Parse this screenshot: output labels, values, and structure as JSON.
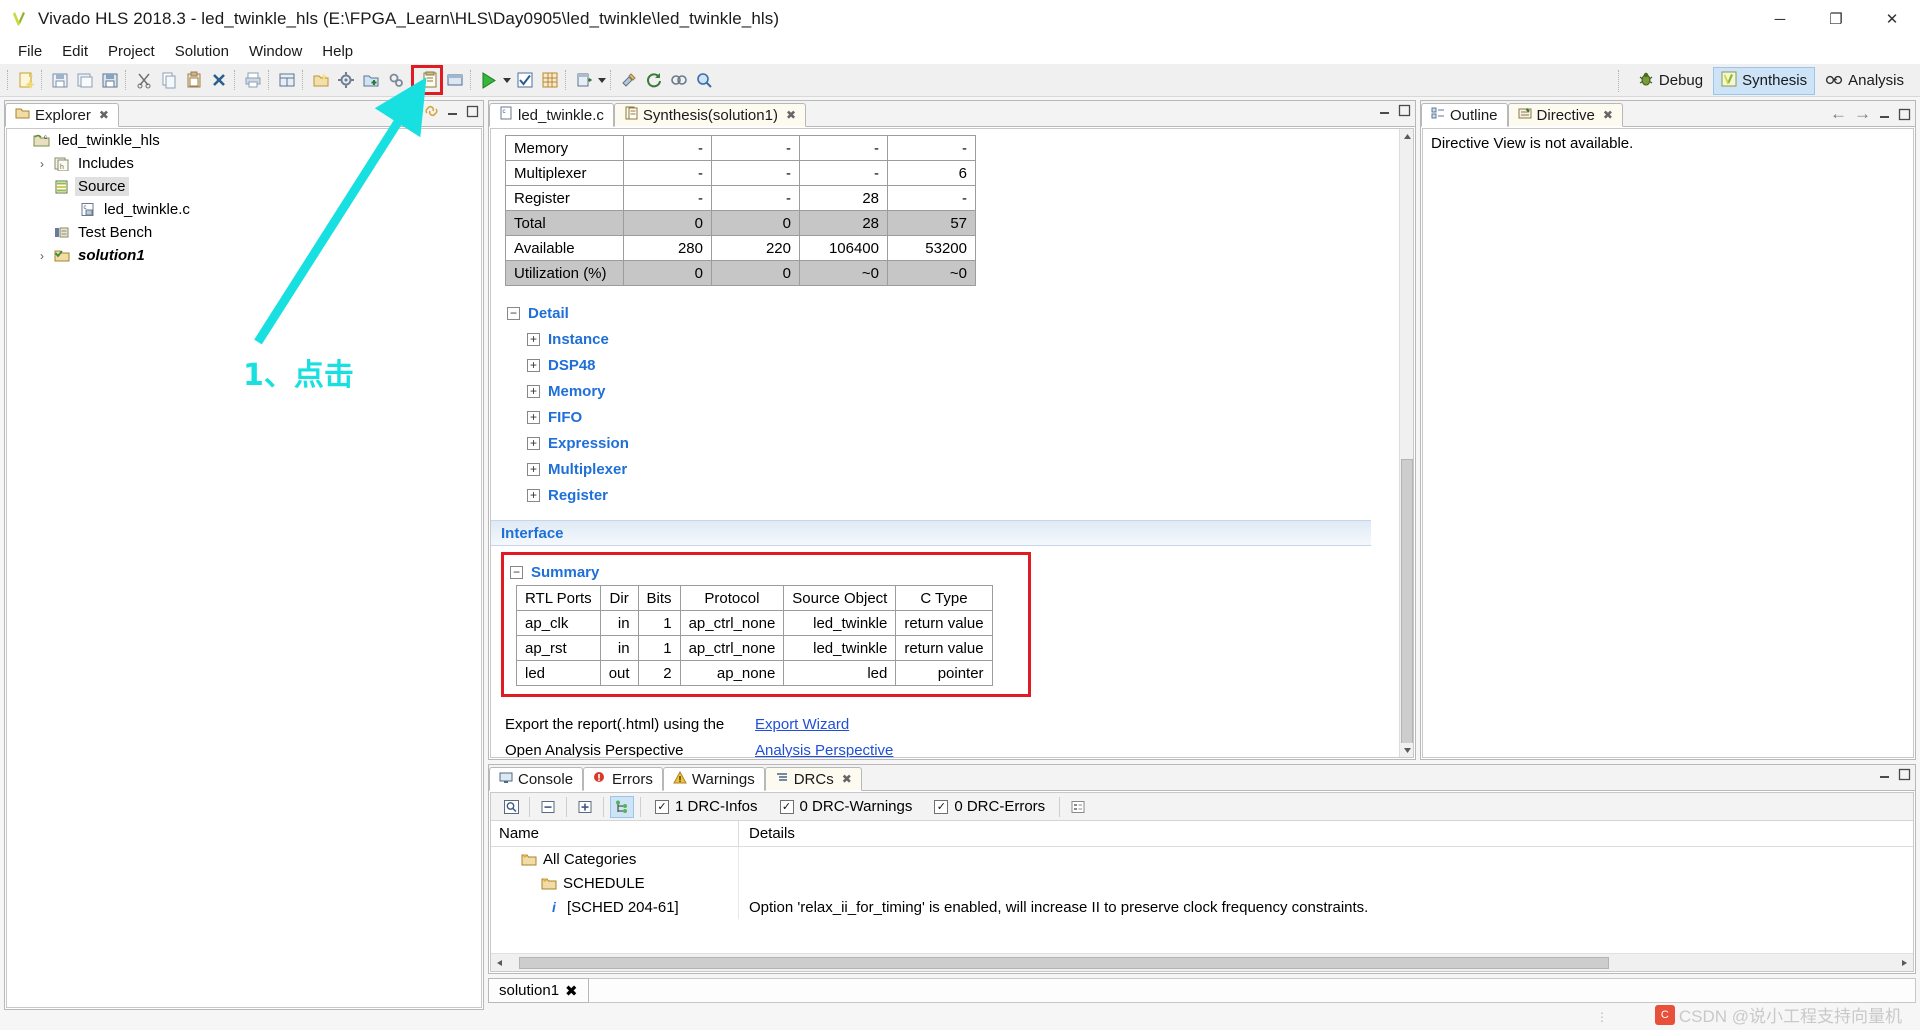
{
  "window": {
    "title": "Vivado HLS 2018.3 - led_twinkle_hls (E:\\FPGA_Learn\\HLS\\Day0905\\led_twinkle\\led_twinkle_hls)",
    "minimize": "─",
    "maximize": "❐",
    "close": "✕"
  },
  "menu": [
    {
      "label": "File"
    },
    {
      "label": "Edit"
    },
    {
      "label": "Project"
    },
    {
      "label": "Solution"
    },
    {
      "label": "Window"
    },
    {
      "label": "Help"
    }
  ],
  "perspectives": [
    {
      "label": "Debug",
      "icon": "bug-icon",
      "active": false
    },
    {
      "label": "Synthesis",
      "icon": "synthesis-icon",
      "active": true
    },
    {
      "label": "Analysis",
      "icon": "glasses-icon",
      "active": false
    }
  ],
  "explorer": {
    "tab_label": "Explorer",
    "tree": [
      {
        "label": "led_twinkle_hls",
        "indent": 0,
        "twisty": "ⱟ",
        "icon": "project-folder-icon",
        "selected": false,
        "bold_italic": false
      },
      {
        "label": "Includes",
        "indent": 1,
        "twisty": "›",
        "icon": "includes-icon",
        "selected": false,
        "bold_italic": false
      },
      {
        "label": "Source",
        "indent": 1,
        "twisty": "ⱟ",
        "icon": "source-folder-icon",
        "selected": true,
        "bold_italic": false
      },
      {
        "label": "led_twinkle.c",
        "indent": 2,
        "twisty": "",
        "icon": "c-file-icon",
        "selected": false,
        "bold_italic": false
      },
      {
        "label": "Test Bench",
        "indent": 1,
        "twisty": "",
        "icon": "testbench-icon",
        "selected": false,
        "bold_italic": false
      },
      {
        "label": "solution1",
        "indent": 1,
        "twisty": "›",
        "icon": "solution-folder-icon",
        "selected": false,
        "bold_italic": true
      }
    ]
  },
  "editor": {
    "tabs": [
      {
        "label": "led_twinkle.c",
        "icon": "c-file-icon",
        "active": false,
        "closable": false
      },
      {
        "label": "Synthesis(solution1)",
        "icon": "report-icon",
        "active": true,
        "closable": true
      }
    ],
    "utilization": {
      "rows": [
        {
          "label": "Memory",
          "values": [
            "-",
            "-",
            "-",
            "-"
          ],
          "shaded": false
        },
        {
          "label": "Multiplexer",
          "values": [
            "-",
            "-",
            "-",
            "6"
          ],
          "shaded": false
        },
        {
          "label": "Register",
          "values": [
            "-",
            "-",
            "28",
            "-"
          ],
          "shaded": false
        },
        {
          "label": "Total",
          "values": [
            "0",
            "0",
            "28",
            "57"
          ],
          "shaded": true
        },
        {
          "label": "Available",
          "values": [
            "280",
            "220",
            "106400",
            "53200"
          ],
          "shaded": false
        },
        {
          "label": "Utilization (%)",
          "values": [
            "0",
            "0",
            "~0",
            "~0"
          ],
          "shaded": true
        }
      ]
    },
    "detail": {
      "title": "Detail",
      "expander_open": "−",
      "expander_closed": "+",
      "items": [
        {
          "label": "Instance"
        },
        {
          "label": "DSP48"
        },
        {
          "label": "Memory"
        },
        {
          "label": "FIFO"
        },
        {
          "label": "Expression"
        },
        {
          "label": "Multiplexer"
        },
        {
          "label": "Register"
        }
      ]
    },
    "interface": {
      "title": "Interface",
      "summary_title": "Summary",
      "columns": [
        "RTL Ports",
        "Dir",
        "Bits",
        "Protocol",
        "Source Object",
        "C Type"
      ],
      "rows": [
        [
          "ap_clk",
          "in",
          "1",
          "ap_ctrl_none",
          "led_twinkle",
          "return value"
        ],
        [
          "ap_rst",
          "in",
          "1",
          "ap_ctrl_none",
          "led_twinkle",
          "return value"
        ],
        [
          "led",
          "out",
          "2",
          "ap_none",
          "led",
          "pointer"
        ]
      ]
    },
    "footer": [
      {
        "text": "Export the report(.html) using the",
        "link": "Export Wizard"
      },
      {
        "text": "Open Analysis Perspective",
        "link": "Analysis Perspective"
      }
    ]
  },
  "outline": {
    "tabs": [
      {
        "label": "Outline",
        "icon": "outline-icon",
        "active": false,
        "closable": false
      },
      {
        "label": "Directive",
        "icon": "directive-icon",
        "active": true,
        "closable": true
      }
    ],
    "message": "Directive View is not available.",
    "nav_back": "←",
    "nav_forward": "→"
  },
  "console": {
    "tabs": [
      {
        "label": "Console",
        "icon": "console-icon",
        "active": false,
        "closable": false
      },
      {
        "label": "Errors",
        "icon": "error-icon",
        "active": false,
        "closable": false
      },
      {
        "label": "Warnings",
        "icon": "warning-icon",
        "active": false,
        "closable": false
      },
      {
        "label": "DRCs",
        "icon": "drc-icon",
        "active": true,
        "closable": true
      }
    ],
    "filters": [
      {
        "label": "1 DRC-Infos",
        "checked": true
      },
      {
        "label": "0 DRC-Warnings",
        "checked": true
      },
      {
        "label": "0 DRC-Errors",
        "checked": true
      }
    ],
    "columns": {
      "name": "Name",
      "details": "Details"
    },
    "rows": [
      {
        "indent": 0,
        "twisty": "ⱟ",
        "icon": "category-folder-icon",
        "name": "All Categories",
        "details": ""
      },
      {
        "indent": 1,
        "twisty": "ⱟ",
        "icon": "category-folder-icon",
        "name": "SCHEDULE",
        "details": ""
      },
      {
        "indent": 2,
        "twisty": "",
        "icon": "info-icon",
        "name": "[SCHED 204-61]",
        "details": "Option 'relax_ii_for_timing' is enabled, will increase II to preserve clock frequency constraints."
      }
    ]
  },
  "status": {
    "tab_label": "solution1"
  },
  "annotation": {
    "text": "1、点击",
    "color": "#19e0e0"
  },
  "watermark": {
    "text": "CSDN @说小工程支持向量机"
  },
  "colors": {
    "accent_link": "#1f6fd8",
    "highlight_box": "#e01b24",
    "selected_tab": "#cde3f7"
  }
}
